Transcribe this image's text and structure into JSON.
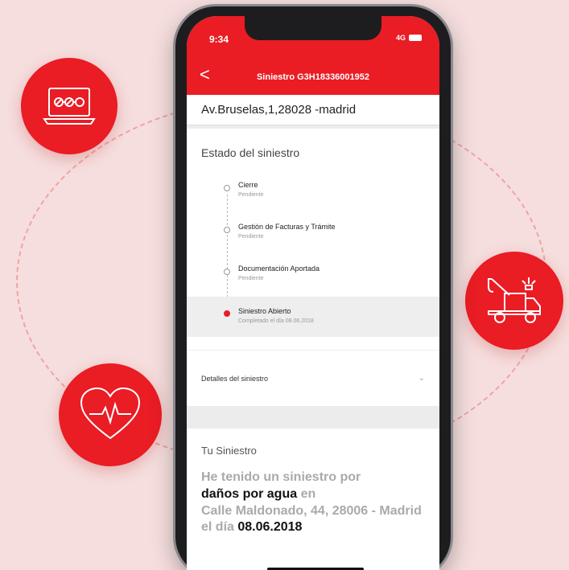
{
  "status": {
    "time": "9:34",
    "signal": "4G"
  },
  "nav": {
    "back_label": "<",
    "title": "Siniestro G3H18336001952"
  },
  "address": "Av.Bruselas,1,28028 -madrid",
  "estado": {
    "title": "Estado del siniestro",
    "items": [
      {
        "name": "Cierre",
        "status": "Pendiente"
      },
      {
        "name": "Gestión de Facturas y Trámite",
        "status": "Pendiente"
      },
      {
        "name": "Documentación Aportada",
        "status": "Pendiente"
      },
      {
        "name": "Siniestro Abierto",
        "status": "Completado el día 08.06.2018"
      }
    ]
  },
  "detalles": {
    "label": "Detalles del siniestro"
  },
  "tu_siniestro": {
    "title": "Tu Siniestro",
    "line1": "He tenido un siniestro por",
    "damage": "daños por agua",
    "en": "en",
    "address": "Calle Maldonado, 44, 28006 - Madrid",
    "el_dia": "el día",
    "date": "08.06.2018"
  },
  "colors": {
    "accent": "#ea1c24",
    "background": "#f6dede"
  },
  "icons": [
    "laptop-icon",
    "tow-truck-icon",
    "heart-pulse-icon"
  ]
}
